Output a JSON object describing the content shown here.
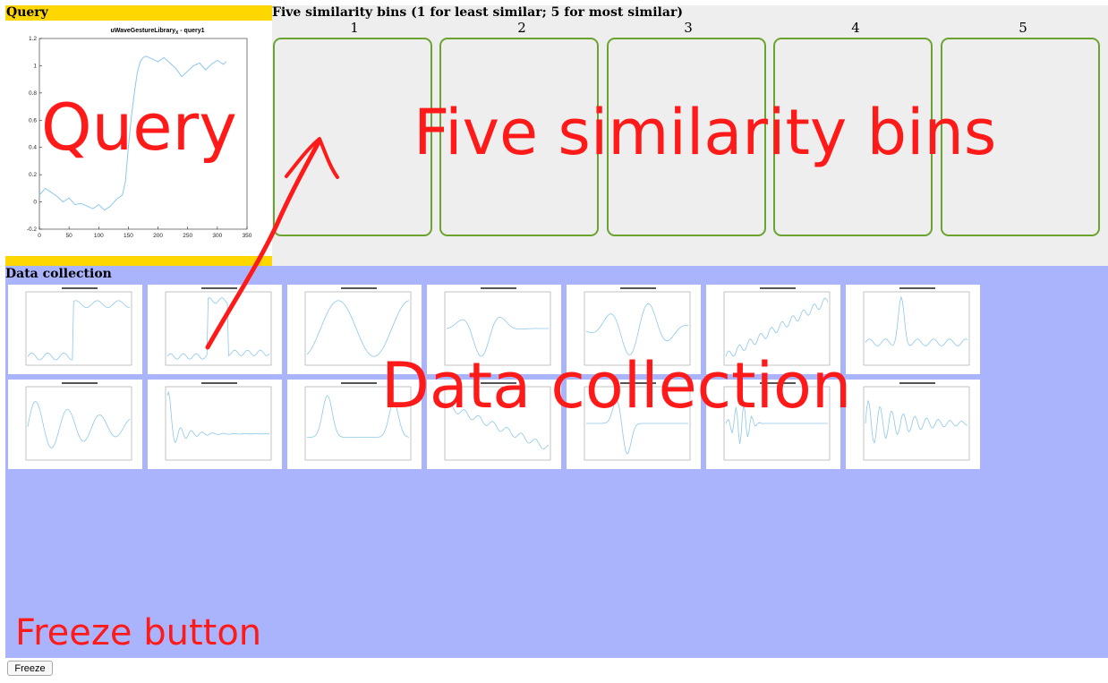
{
  "query": {
    "header": "Query",
    "plot": {
      "title_main": "uWaveGestureLibrary",
      "title_sub": "X",
      "title_rest": " - query1",
      "color": "#8ec7ea"
    },
    "chart_data": {
      "type": "line",
      "title": "uWaveGestureLibraryX - query1",
      "xlim": [
        0,
        350
      ],
      "ylim": [
        -0.2,
        1.2
      ],
      "xticks": [
        "0",
        "50",
        "100",
        "150",
        "200",
        "250",
        "300",
        "350"
      ],
      "yticks": [
        "-0.2",
        "0",
        "0.2",
        "0.4",
        "0.6",
        "0.8",
        "1",
        "1.2"
      ],
      "series": [
        {
          "x": [
            0,
            10,
            20,
            30,
            40,
            50,
            60,
            70,
            80,
            90,
            100,
            110,
            120,
            130,
            140,
            145,
            150,
            155,
            160,
            165,
            170,
            175,
            180,
            190,
            200,
            210,
            220,
            230,
            240,
            250,
            260,
            270,
            280,
            290,
            300,
            310,
            315
          ],
          "y": [
            0.05,
            0.1,
            0.07,
            0.04,
            0.0,
            0.03,
            -0.02,
            -0.01,
            -0.03,
            -0.05,
            -0.02,
            -0.06,
            -0.03,
            0.02,
            0.05,
            0.15,
            0.4,
            0.62,
            0.8,
            0.95,
            1.03,
            1.06,
            1.07,
            1.05,
            1.03,
            1.06,
            1.02,
            0.98,
            0.92,
            0.96,
            1.0,
            1.02,
            0.97,
            1.01,
            1.04,
            1.01,
            1.03
          ]
        }
      ]
    }
  },
  "bins": {
    "title": "Five similarity bins (1 for least similar; 5 for most similar)",
    "labels": [
      "1",
      "2",
      "3",
      "4",
      "5"
    ],
    "border_color": "#6aa32e"
  },
  "data_collection": {
    "title": "Data collection",
    "series_color": "#8ec7ea"
  },
  "freeze_button": {
    "label": "Freeze"
  },
  "annotations": {
    "query": "Query",
    "bins": "Five similarity bins",
    "data": "Data collection",
    "freeze": "Freeze button",
    "color": "#ff1a1a"
  }
}
